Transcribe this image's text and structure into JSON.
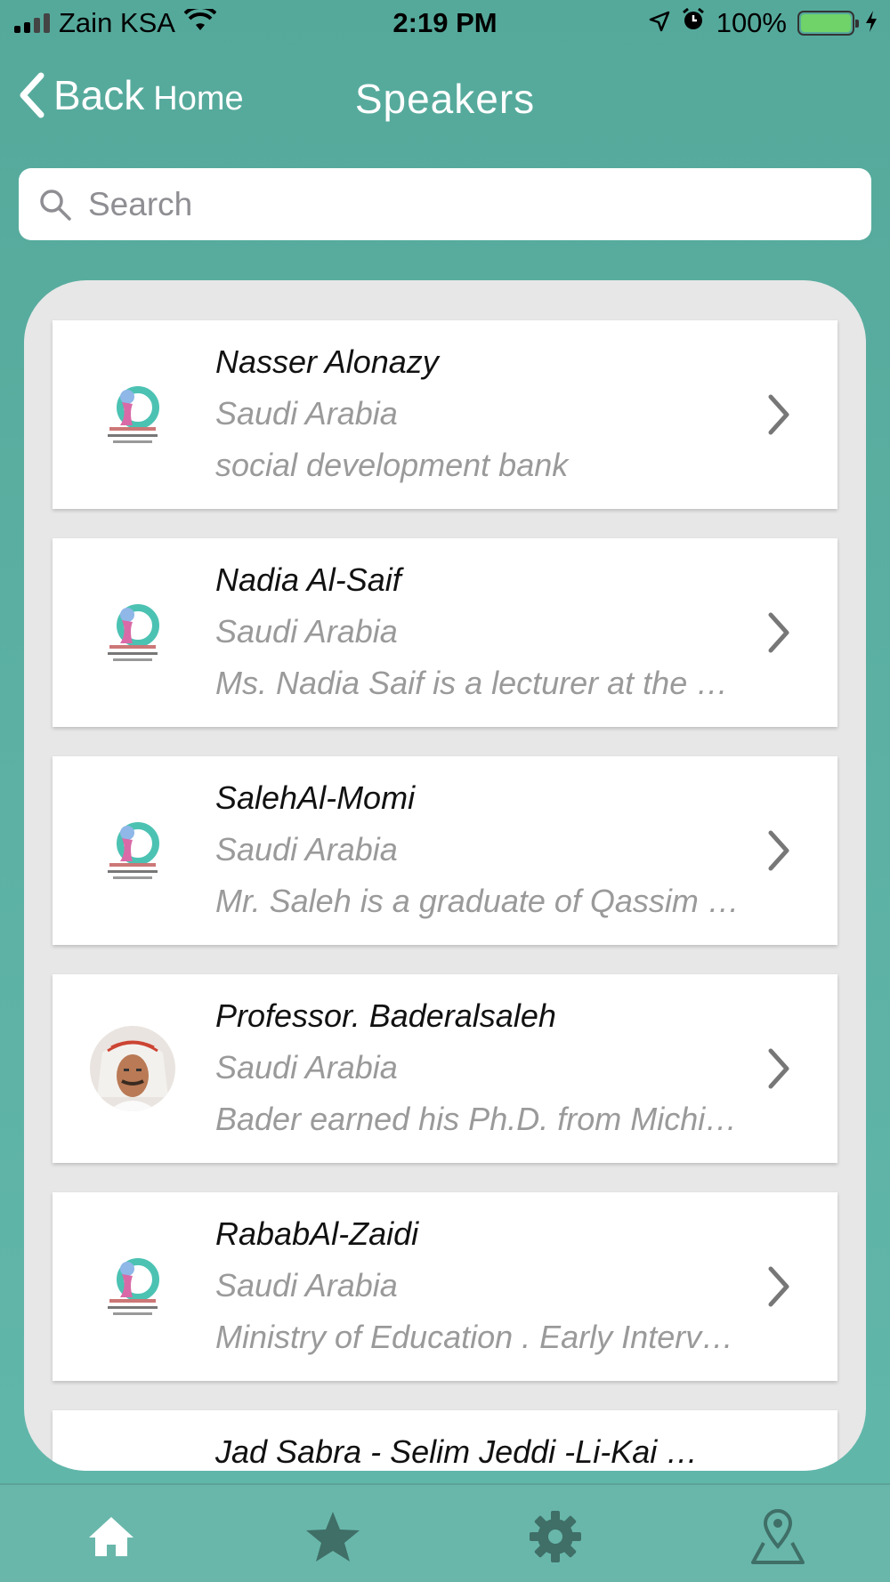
{
  "status_bar": {
    "carrier": "Zain KSA",
    "time": "2:19 PM",
    "battery": "100%"
  },
  "nav": {
    "back_label": "Back",
    "back_home": "Home",
    "title": "Speakers"
  },
  "search": {
    "placeholder": "Search",
    "value": ""
  },
  "speakers": [
    {
      "name": "Nasser Alonazy",
      "country": "Saudi Arabia",
      "bio": "social development bank",
      "avatar": "conference-logo"
    },
    {
      "name": "Nadia Al-Saif",
      "country": "Saudi Arabia",
      "bio": "Ms. Nadia Saif is a lecturer at the E…",
      "avatar": "conference-logo"
    },
    {
      "name": "SalehAl-Momi",
      "country": "Saudi Arabia",
      "bio": "Mr. Saleh is a graduate of Qassim …",
      "avatar": "conference-logo"
    },
    {
      "name": "Professor. Baderalsaleh",
      "country": "Saudi Arabia",
      "bio": "Bader earned his Ph.D. from Michi…",
      "avatar": "speaker-photo"
    },
    {
      "name": "RababAl-Zaidi",
      "country": "Saudi Arabia",
      "bio": "Ministry of Education . Early Interv…",
      "avatar": "conference-logo"
    },
    {
      "name": "Jad Sabra - Selim Jeddi -Li-Kai …",
      "country": "",
      "bio": "",
      "avatar": ""
    }
  ],
  "tabs": [
    {
      "icon": "home-icon",
      "active": true
    },
    {
      "icon": "star-icon",
      "active": false
    },
    {
      "icon": "gear-icon",
      "active": false
    },
    {
      "icon": "map-pin-icon",
      "active": false
    }
  ],
  "colors": {
    "background": "#58ac9f",
    "panel": "#e7e7e7",
    "tab_bar": "#69b7ab",
    "tab_icon": "#3f6f67",
    "secondary_text": "#9a9a9a"
  }
}
